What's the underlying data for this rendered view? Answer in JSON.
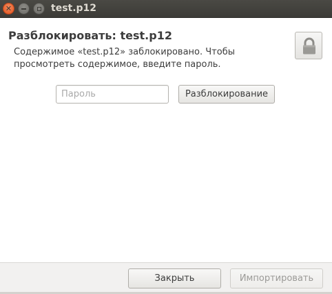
{
  "window": {
    "title": "test.p12",
    "close_icon": "close-icon",
    "minimize_icon": "minimize-icon",
    "maximize_icon": "maximize-icon"
  },
  "content": {
    "heading": "Разблокировать: test.p12",
    "description": "Содержимое «test.p12» заблокировано. Чтобы просмотреть содержимое, введите пароль.",
    "lock_icon": "lock-icon",
    "password": {
      "value": "",
      "placeholder": "Пароль"
    },
    "unlock_button_label": "Разблокирование"
  },
  "footer": {
    "close_button_label": "Закрыть",
    "import_button_label": "Импортировать",
    "import_enabled": false
  },
  "colors": {
    "titlebar": "#3c3b37",
    "close_button": "#e2531f",
    "text": "#3c3c3c",
    "disabled_text": "#9b9a97"
  }
}
